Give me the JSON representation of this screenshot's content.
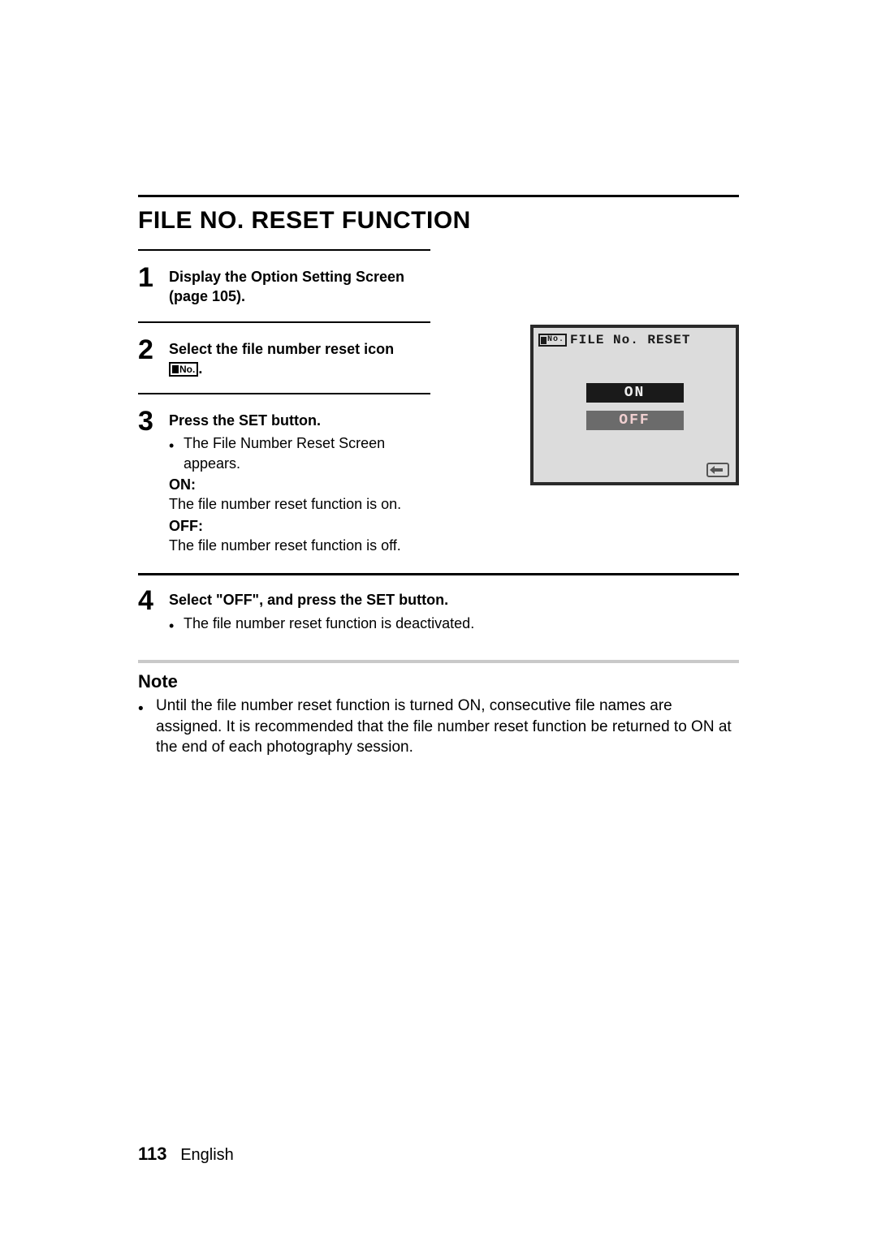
{
  "title": "FILE NO. RESET FUNCTION",
  "icon_label": "No.",
  "steps": [
    {
      "num": "1",
      "title": "Display the Option Setting Screen (page 105)."
    },
    {
      "num": "2",
      "title_prefix": "Select the file number reset icon ",
      "title_suffix": "."
    },
    {
      "num": "3",
      "title": "Press the SET button.",
      "bullet": "The File Number Reset Screen appears.",
      "on_label": "ON:",
      "on_text": "The file number reset function is on.",
      "off_label": "OFF:",
      "off_text": "The file number reset function is off."
    },
    {
      "num": "4",
      "title": "Select \"OFF\", and press the SET button.",
      "bullet": "The file number reset function is deactivated."
    }
  ],
  "screen": {
    "header": "FILE No. RESET",
    "icon_label": "No.",
    "option_on": "ON",
    "option_off": "OFF"
  },
  "note": {
    "heading": "Note",
    "text": "Until the file number reset function is turned ON, consecutive file names are assigned. It is recommended that the file number reset function be returned to ON at the end of each photography session."
  },
  "footer": {
    "page_num": "113",
    "lang": "English"
  }
}
